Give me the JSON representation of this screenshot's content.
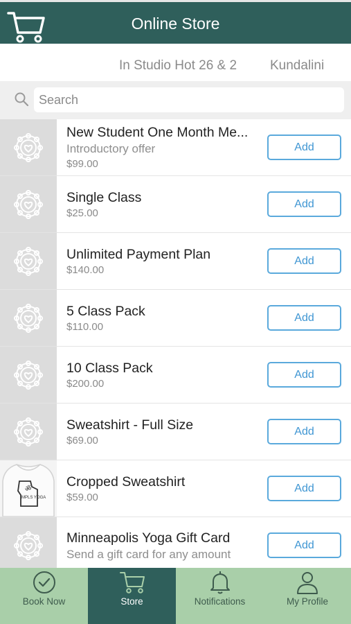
{
  "header": {
    "title": "Online Store",
    "cart_icon": "shopping-cart-icon",
    "bg_color": "#2f5f5b"
  },
  "tabs": [
    {
      "label": "In Studio Hot 26 & 2"
    },
    {
      "label": "Kundalini"
    }
  ],
  "search": {
    "placeholder": "Search",
    "value": ""
  },
  "products": [
    {
      "name": "New Student One Month Me...",
      "subtitle": "Introductory offer",
      "price": "$99.00",
      "button": "Add",
      "thumb": "lotus-logo"
    },
    {
      "name": "Single Class",
      "subtitle": "",
      "price": "$25.00",
      "button": "Add",
      "thumb": "lotus-logo"
    },
    {
      "name": "Unlimited Payment Plan",
      "subtitle": "",
      "price": "$140.00",
      "button": "Add",
      "thumb": "lotus-logo"
    },
    {
      "name": "5 Class Pack",
      "subtitle": "",
      "price": "$110.00",
      "button": "Add",
      "thumb": "lotus-logo"
    },
    {
      "name": "10 Class Pack",
      "subtitle": "",
      "price": "$200.00",
      "button": "Add",
      "thumb": "lotus-logo"
    },
    {
      "name": "Sweatshirt - Full Size",
      "subtitle": "",
      "price": "$69.00",
      "button": "Add",
      "thumb": "lotus-logo"
    },
    {
      "name": "Cropped Sweatshirt",
      "subtitle": "",
      "price": "$59.00",
      "button": "Add",
      "thumb": "sweatshirt-photo",
      "thumb_text": "MPLS YOGA"
    },
    {
      "name": "Minneapolis Yoga Gift Card",
      "subtitle": "Send a gift card for any amount",
      "price": "",
      "button": "Add",
      "thumb": "lotus-logo"
    }
  ],
  "bottom_nav": [
    {
      "label": "Book Now",
      "icon": "check-circle-icon",
      "active": false
    },
    {
      "label": "Store",
      "icon": "shopping-cart-icon",
      "active": true
    },
    {
      "label": "Notifications",
      "icon": "bell-icon",
      "active": false
    },
    {
      "label": "My Profile",
      "icon": "person-icon",
      "active": false
    }
  ],
  "colors": {
    "accent": "#2f5f5b",
    "nav_bg": "#a9cfa9",
    "button_border": "#5aa9dc",
    "button_text": "#3f96d3"
  }
}
